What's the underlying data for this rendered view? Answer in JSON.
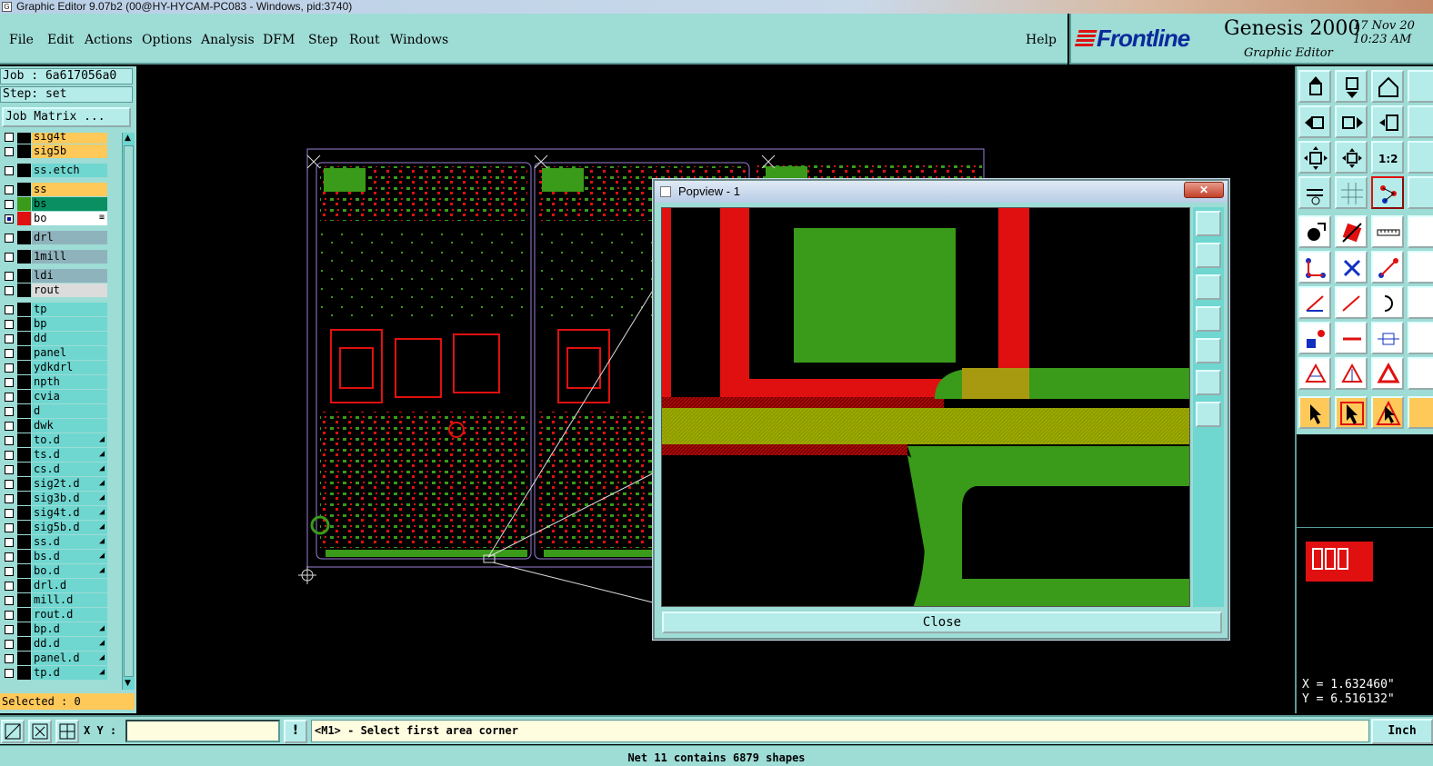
{
  "window": {
    "title": "Graphic Editor 9.07b2 (00@HY-HYCAM-PC083 - Windows, pid:3740)"
  },
  "menu": {
    "items": [
      "File",
      "Edit",
      "Actions",
      "Options",
      "Analysis",
      "DFM",
      "Step",
      "Rout",
      "Windows"
    ],
    "help": "Help"
  },
  "brand": {
    "logo": "Frontline",
    "product": "Genesis 2000",
    "subtitle": "Graphic Editor",
    "date": "17 Nov 20",
    "time": "10:23 AM"
  },
  "job": {
    "job_label": "Job : 6a617056a0",
    "step_label": "Step: set",
    "matrix_button": "Job Matrix ..."
  },
  "layers": [
    {
      "name": "sig4t",
      "color": "#ffc95a",
      "checked": false,
      "swatch": "#000000",
      "mark": ""
    },
    {
      "name": "sig5b",
      "color": "#ffc95a",
      "checked": false,
      "swatch": "#000000",
      "mark": ""
    },
    {
      "name": "ss.etch",
      "color": "#6fd6d0",
      "checked": false,
      "swatch": "#000000",
      "mark": ""
    },
    {
      "name": "ss",
      "color": "#ffc95a",
      "checked": false,
      "swatch": "#000000",
      "mark": ""
    },
    {
      "name": "bs",
      "color": "#0a8f63",
      "checked": false,
      "swatch": "#3a9a1a",
      "mark": ""
    },
    {
      "name": "bo",
      "color": "#ffffff",
      "checked": true,
      "swatch": "#e01010",
      "mark": "≡"
    },
    {
      "name": "drl",
      "color": "#8fb3bc",
      "checked": false,
      "swatch": "#000000",
      "mark": ""
    },
    {
      "name": "1mill",
      "color": "#8fb3bc",
      "checked": false,
      "swatch": "#000000",
      "mark": ""
    },
    {
      "name": "ldi",
      "color": "#8fb3bc",
      "checked": false,
      "swatch": "#000000",
      "mark": ""
    },
    {
      "name": "rout",
      "color": "#dcdcdc",
      "checked": false,
      "swatch": "#000000",
      "mark": ""
    },
    {
      "name": "tp",
      "color": "#6fd6d0",
      "checked": false,
      "swatch": "#000000",
      "mark": ""
    },
    {
      "name": "bp",
      "color": "#6fd6d0",
      "checked": false,
      "swatch": "#000000",
      "mark": ""
    },
    {
      "name": "dd",
      "color": "#6fd6d0",
      "checked": false,
      "swatch": "#000000",
      "mark": ""
    },
    {
      "name": "panel",
      "color": "#6fd6d0",
      "checked": false,
      "swatch": "#000000",
      "mark": ""
    },
    {
      "name": "ydkdrl",
      "color": "#6fd6d0",
      "checked": false,
      "swatch": "#000000",
      "mark": ""
    },
    {
      "name": "npth",
      "color": "#6fd6d0",
      "checked": false,
      "swatch": "#000000",
      "mark": ""
    },
    {
      "name": "cvia",
      "color": "#6fd6d0",
      "checked": false,
      "swatch": "#000000",
      "mark": ""
    },
    {
      "name": "d",
      "color": "#6fd6d0",
      "checked": false,
      "swatch": "#000000",
      "mark": ""
    },
    {
      "name": "dwk",
      "color": "#6fd6d0",
      "checked": false,
      "swatch": "#000000",
      "mark": ""
    },
    {
      "name": "to.d",
      "color": "#6fd6d0",
      "checked": false,
      "swatch": "#000000",
      "mark": "◢"
    },
    {
      "name": "ts.d",
      "color": "#6fd6d0",
      "checked": false,
      "swatch": "#000000",
      "mark": "◢"
    },
    {
      "name": "cs.d",
      "color": "#6fd6d0",
      "checked": false,
      "swatch": "#000000",
      "mark": "◢"
    },
    {
      "name": "sig2t.d",
      "color": "#6fd6d0",
      "checked": false,
      "swatch": "#000000",
      "mark": "◢"
    },
    {
      "name": "sig3b.d",
      "color": "#6fd6d0",
      "checked": false,
      "swatch": "#000000",
      "mark": "◢"
    },
    {
      "name": "sig4t.d",
      "color": "#6fd6d0",
      "checked": false,
      "swatch": "#000000",
      "mark": "◢"
    },
    {
      "name": "sig5b.d",
      "color": "#6fd6d0",
      "checked": false,
      "swatch": "#000000",
      "mark": "◢"
    },
    {
      "name": "ss.d",
      "color": "#6fd6d0",
      "checked": false,
      "swatch": "#000000",
      "mark": "◢"
    },
    {
      "name": "bs.d",
      "color": "#6fd6d0",
      "checked": false,
      "swatch": "#000000",
      "mark": "◢"
    },
    {
      "name": "bo.d",
      "color": "#6fd6d0",
      "checked": false,
      "swatch": "#000000",
      "mark": "◢"
    },
    {
      "name": "drl.d",
      "color": "#6fd6d0",
      "checked": false,
      "swatch": "#000000",
      "mark": ""
    },
    {
      "name": "mill.d",
      "color": "#6fd6d0",
      "checked": false,
      "swatch": "#000000",
      "mark": ""
    },
    {
      "name": "rout.d",
      "color": "#6fd6d0",
      "checked": false,
      "swatch": "#000000",
      "mark": ""
    },
    {
      "name": "bp.d",
      "color": "#6fd6d0",
      "checked": false,
      "swatch": "#000000",
      "mark": "◢"
    },
    {
      "name": "dd.d",
      "color": "#6fd6d0",
      "checked": false,
      "swatch": "#000000",
      "mark": "◢"
    },
    {
      "name": "panel.d",
      "color": "#6fd6d0",
      "checked": false,
      "swatch": "#000000",
      "mark": "◢"
    },
    {
      "name": "tp.d",
      "color": "#6fd6d0",
      "checked": false,
      "swatch": "#000000",
      "mark": "◢"
    }
  ],
  "selected": "Selected : 0",
  "popview": {
    "title": "Popview - 1",
    "close_x": "✕",
    "close_button": "Close"
  },
  "coords": {
    "x": "X = 1.632460\"",
    "y": "Y = 6.516132\""
  },
  "bottom": {
    "xy_label": "X Y :",
    "xy_value": "",
    "warn": "!",
    "prompt": "<M1> - Select first area corner",
    "unit": "Inch"
  },
  "status": "Net 11 contains 6879 shapes",
  "colors": {
    "panel": "#9edcd6",
    "layer_red": "#e01010",
    "layer_green": "#3a9a1a",
    "highlight": "#ffc95a"
  }
}
